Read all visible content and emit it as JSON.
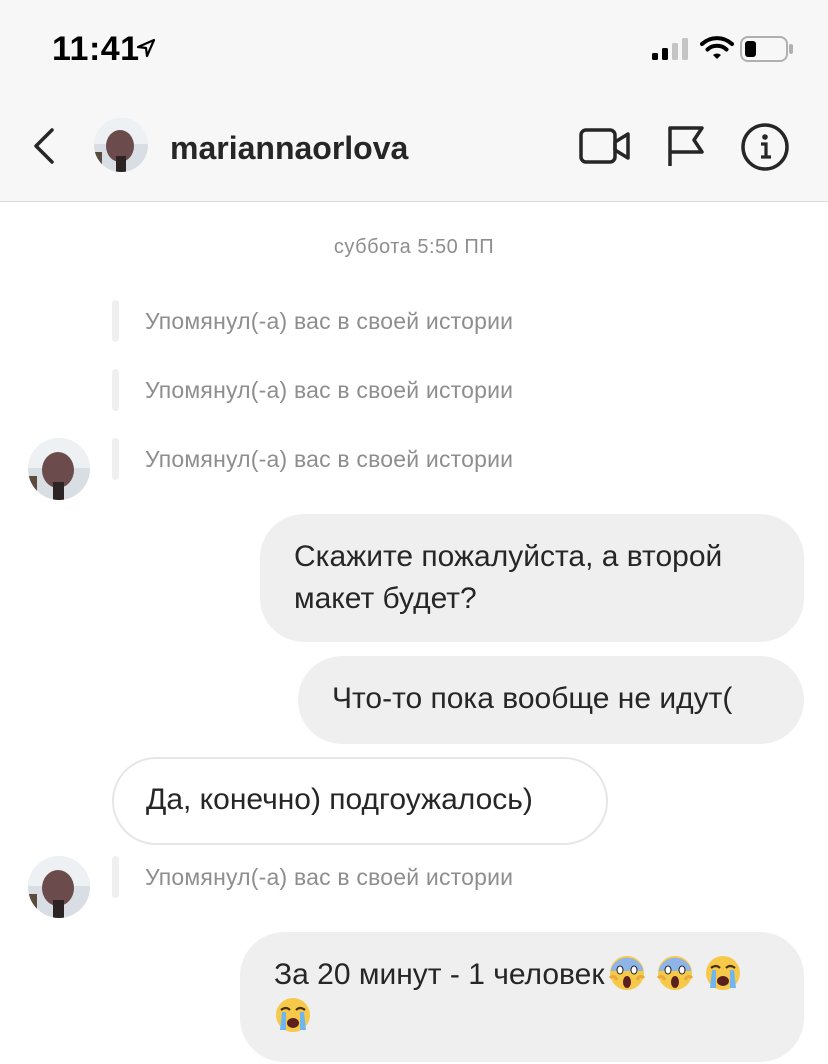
{
  "status_bar": {
    "time": "11:41",
    "location_icon": "location-arrow-icon",
    "signal_icon": "cellular-signal-icon",
    "wifi_icon": "wifi-icon",
    "battery_icon": "battery-icon"
  },
  "header": {
    "username": "mariannaorlova",
    "back_icon": "chevron-left-icon",
    "video_icon": "video-camera-icon",
    "flag_icon": "flag-icon",
    "info_icon": "info-icon"
  },
  "chat": {
    "timestamp": "суббота 5:50 ПП",
    "mention_text": "Упомянул(-а) вас в своей истории",
    "messages": [
      {
        "text": "Скажите пожалуйста, а второй макет будет?"
      },
      {
        "text": "Что-то пока вообще не идут("
      },
      {
        "text": "Да, конечно) подгоужалось)"
      },
      {
        "text": "За 20 минут - 1 человек"
      }
    ],
    "emojis": [
      "face-screaming-emoji",
      "face-screaming-emoji",
      "loudly-crying-emoji",
      "loudly-crying-emoji"
    ]
  },
  "colors": {
    "header_bg": "#f7f7f7",
    "bubble_out": "#efefef",
    "bubble_in_border": "#e6e6e6",
    "muted_text": "#8e8e8e"
  }
}
